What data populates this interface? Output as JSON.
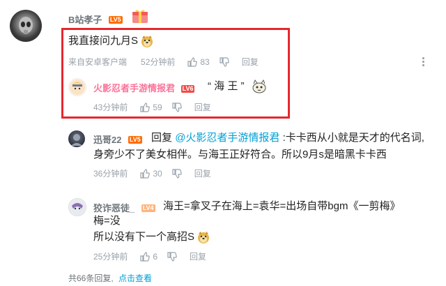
{
  "top_comment": {
    "username": "B站孝子",
    "level": "LV5",
    "text": "我直接问九月S",
    "source": "来自安卓客户端",
    "time": "52分钟前",
    "likes": "83",
    "reply_label": "回复"
  },
  "reply1": {
    "username": "火影忍者手游情报君",
    "level": "LV6",
    "text": "“ 海 王 ”",
    "time": "43分钟前",
    "likes": "59",
    "reply_label": "回复"
  },
  "reply2": {
    "username": "迅哥22",
    "level": "LV5",
    "reply_prefix": "回复",
    "mention": "@火影忍者手游情报君",
    "line1_rest": ":卡卡西从小就是天才的代名词,",
    "line2": "身旁少不了美女相伴。与海王正好符合。所以9月s是暗黑卡卡西",
    "time": "36分钟前",
    "likes": "30",
    "reply_label": "回复"
  },
  "reply3": {
    "username": "狡诈恶徒_",
    "level": "LV4",
    "line1": "海王=拿叉子在海上=袁华=出场自带bgm《一剪梅》",
    "line2": "梅=没",
    "line3": "所以没有下一个高招S",
    "time": "25分钟前",
    "likes": "6",
    "reply_label": "回复"
  },
  "footer": {
    "total_label": "共66条回复,",
    "view_label": "点击查看"
  },
  "colors": {
    "highlight_box": "#e5282d",
    "link": "#00a1d6",
    "vip_name": "#fb7299",
    "meta": "#99a2aa"
  }
}
